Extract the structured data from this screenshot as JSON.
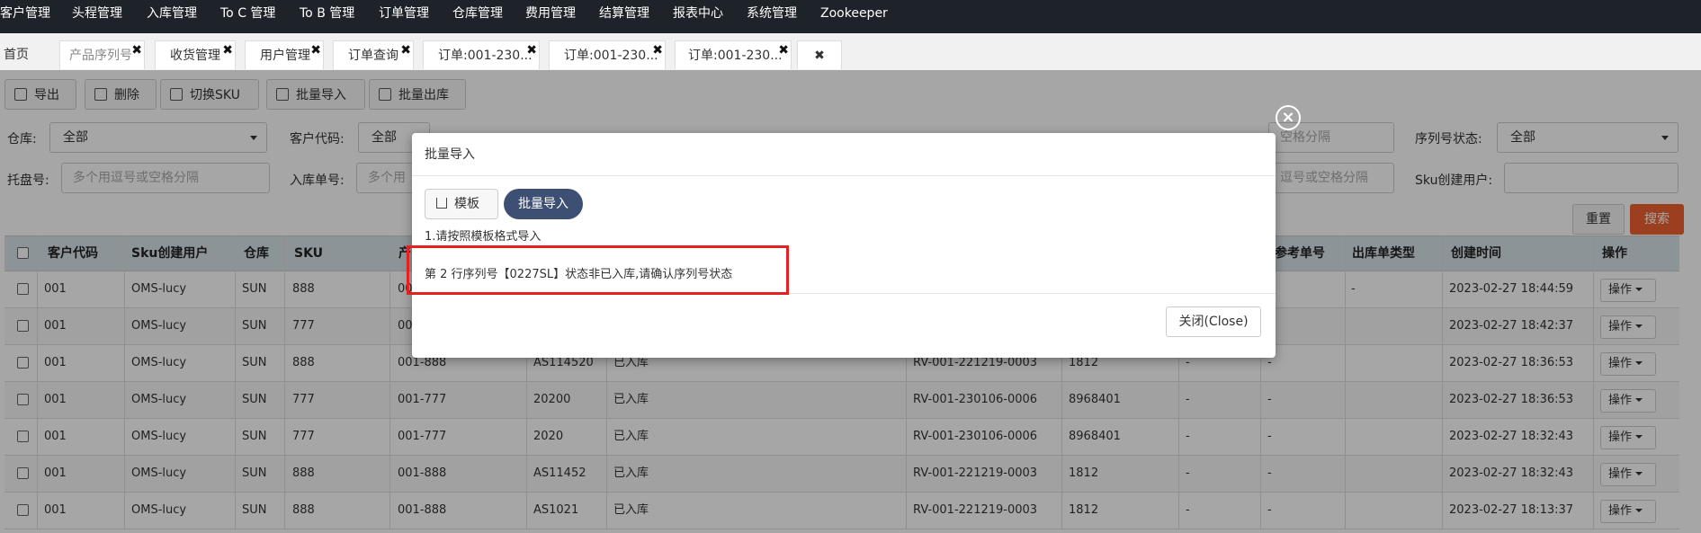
{
  "nav": [
    "客户管理",
    "头程管理",
    "入库管理",
    "To C 管理",
    "To B 管理",
    "订单管理",
    "仓库管理",
    "费用管理",
    "结算管理",
    "报表中心",
    "系统管理",
    "Zookeeper"
  ],
  "tabs": {
    "home": "首页",
    "items": [
      {
        "label": "产品序列号",
        "close": "✖"
      },
      {
        "label": "收货管理",
        "close": "✖"
      },
      {
        "label": "用户管理",
        "close": "✖"
      },
      {
        "label": "订单查询",
        "close": "✖"
      },
      {
        "label": "订单:001-230...",
        "close": "✖"
      },
      {
        "label": "订单:001-230...",
        "close": "✖"
      },
      {
        "label": "订单:001-230...",
        "close": "✖"
      }
    ],
    "close_all": "✖"
  },
  "toolbar": {
    "export": "导出",
    "delete": "删除",
    "switch_sku": "切换SKU",
    "batch_import": "批量导入",
    "batch_outbound": "批量出库"
  },
  "filters": {
    "warehouse_label": "仓库:",
    "warehouse_value": "全部",
    "customer_code_label": "客户代码:",
    "customer_code_value": "全部",
    "serial_status_label": "序列号状态:",
    "serial_status_value": "全部",
    "pallet_label": "托盘号:",
    "pallet_placeholder": "多个用逗号或空格分隔",
    "inbound_no_label": "入库单号:",
    "inbound_no_placeholder": "多个用",
    "sku_user_label": "Sku创建用户:",
    "right_placeholder_1": "空格分隔",
    "right_placeholder_2": "逗号或空格分隔",
    "reset": "重置",
    "search": "搜索"
  },
  "table": {
    "headers": [
      "客户代码",
      "Sku创建用户",
      "仓库",
      "SKU",
      "产",
      "参考单号",
      "出库单类型",
      "创建时间",
      "操作"
    ],
    "op_label": "操作",
    "rows": [
      {
        "c": "001",
        "u": "OMS-lucy",
        "w": "SUN",
        "sku": "888",
        "p": "00",
        "sn": "",
        "st": "",
        "rv": "",
        "ref": "",
        "d1": "",
        "d2": "",
        "t": "-",
        "time": "2023-02-27 18:44:59"
      },
      {
        "c": "001",
        "u": "OMS-lucy",
        "w": "SUN",
        "sku": "777",
        "p": "00",
        "sn": "",
        "st": "",
        "rv": "",
        "ref": "",
        "d1": "",
        "d2": "",
        "t": "",
        "time": "2023-02-27 18:42:37"
      },
      {
        "c": "001",
        "u": "OMS-lucy",
        "w": "SUN",
        "sku": "888",
        "p": "001-888",
        "sn": "AS114520",
        "st": "已入库",
        "rv": "RV-001-221219-0003",
        "ref": "1812",
        "d1": "-",
        "d2": "-",
        "t": "",
        "time": "2023-02-27 18:36:53"
      },
      {
        "c": "001",
        "u": "OMS-lucy",
        "w": "SUN",
        "sku": "777",
        "p": "001-777",
        "sn": "20200",
        "st": "已入库",
        "rv": "RV-001-230106-0006",
        "ref": "8968401",
        "d1": "-",
        "d2": "-",
        "t": "",
        "time": "2023-02-27 18:36:53"
      },
      {
        "c": "001",
        "u": "OMS-lucy",
        "w": "SUN",
        "sku": "777",
        "p": "001-777",
        "sn": "2020",
        "st": "已入库",
        "rv": "RV-001-230106-0006",
        "ref": "8968401",
        "d1": "-",
        "d2": "-",
        "t": "",
        "time": "2023-02-27 18:32:43"
      },
      {
        "c": "001",
        "u": "OMS-lucy",
        "w": "SUN",
        "sku": "888",
        "p": "001-888",
        "sn": "AS11452",
        "st": "已入库",
        "rv": "RV-001-221219-0003",
        "ref": "1812",
        "d1": "-",
        "d2": "-",
        "t": "",
        "time": "2023-02-27 18:32:43"
      },
      {
        "c": "001",
        "u": "OMS-lucy",
        "w": "SUN",
        "sku": "888",
        "p": "001-888",
        "sn": "AS1021",
        "st": "已入库",
        "rv": "RV-001-221219-0003",
        "ref": "1812",
        "d1": "-",
        "d2": "-",
        "t": "",
        "time": "2023-02-27 18:13:37"
      }
    ]
  },
  "modal": {
    "title": "批量导入",
    "template_btn": "模板",
    "import_btn": "批量导入",
    "instruction": "1.请按照模板格式导入",
    "error": "第 2 行序列号【0227SL】状态非已入库,请确认序列号状态",
    "close_btn": "关闭(Close)",
    "close_icon": "×"
  }
}
